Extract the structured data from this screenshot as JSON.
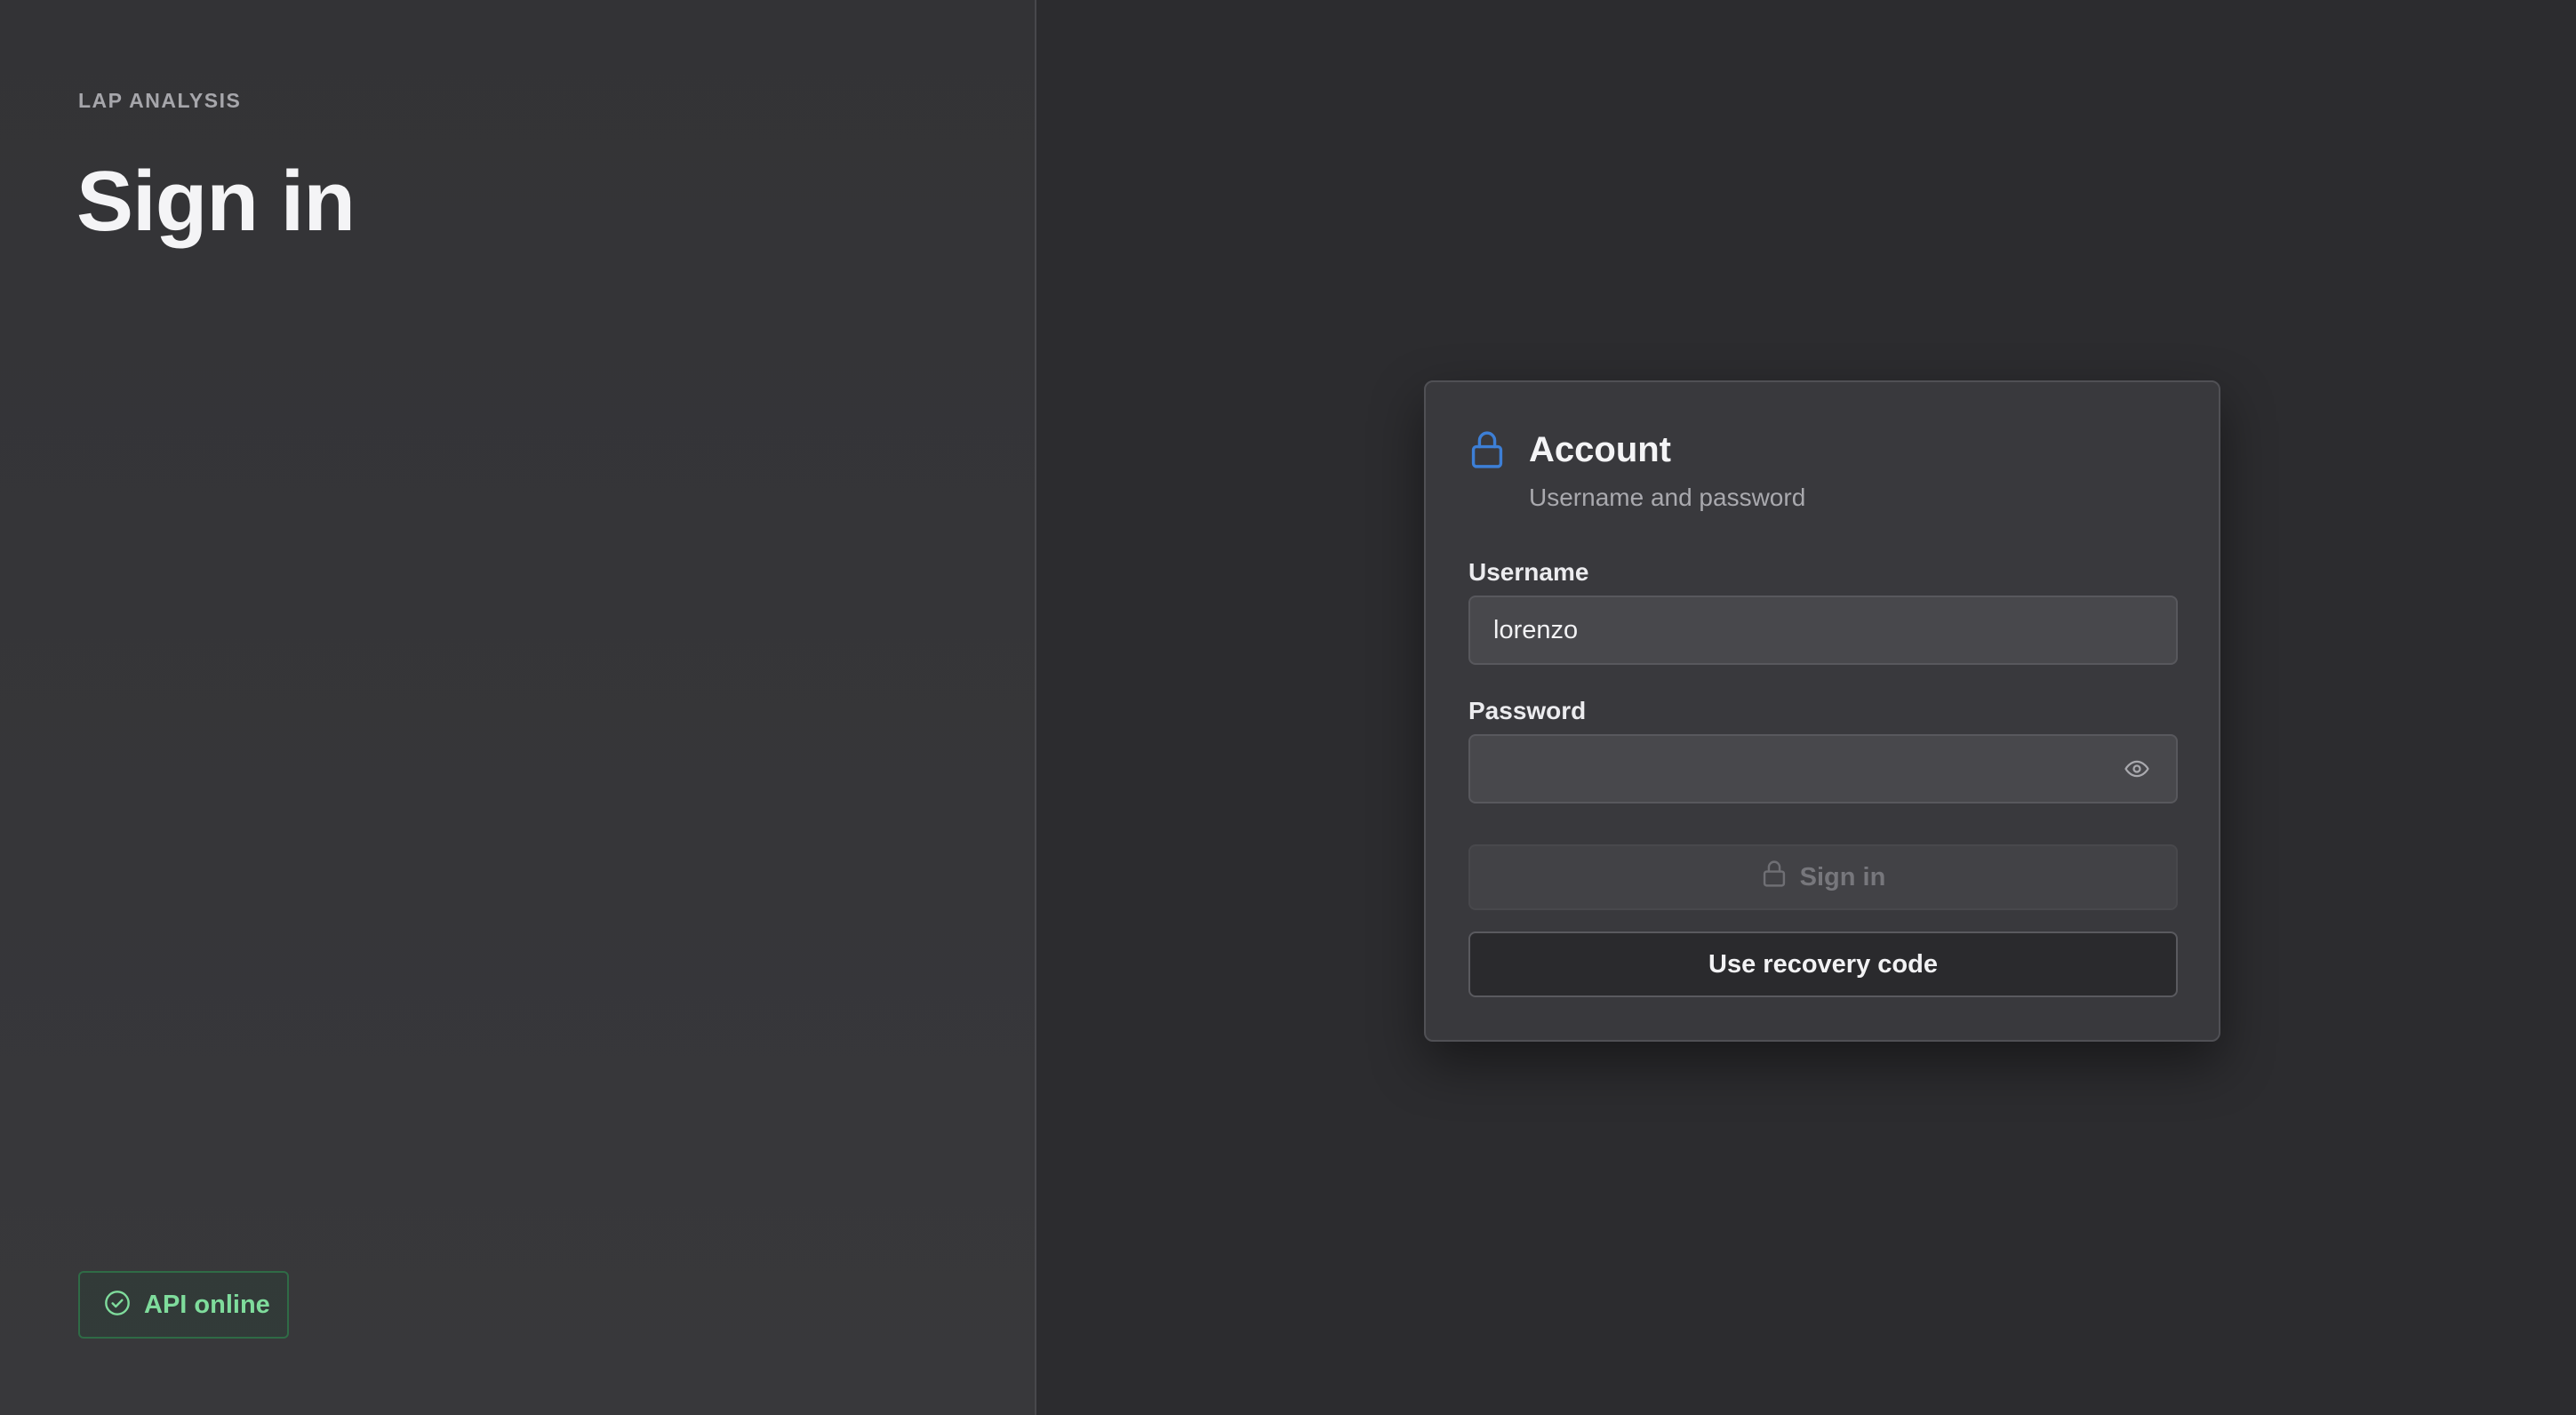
{
  "left_panel": {
    "eyebrow": "LAP ANALYSIS",
    "title": "Sign in",
    "status_badge": {
      "label": "API online",
      "icon": "check-circle-icon",
      "color": "#7fdc9c"
    }
  },
  "card": {
    "icon": "lock-icon",
    "title": "Account",
    "subtitle": "Username and password",
    "username": {
      "label": "Username",
      "value": "lorenzo"
    },
    "password": {
      "label": "Password",
      "value": "",
      "toggle_icon": "eye-icon"
    },
    "sign_in_button": {
      "label": "Sign in",
      "icon": "lock-icon",
      "enabled": false
    },
    "recovery_button": {
      "label": "Use recovery code"
    }
  },
  "colors": {
    "accent_blue": "#3d7fd6",
    "status_green": "#7fdc9c",
    "background": "#2c2c2f",
    "card": "#39393d"
  }
}
